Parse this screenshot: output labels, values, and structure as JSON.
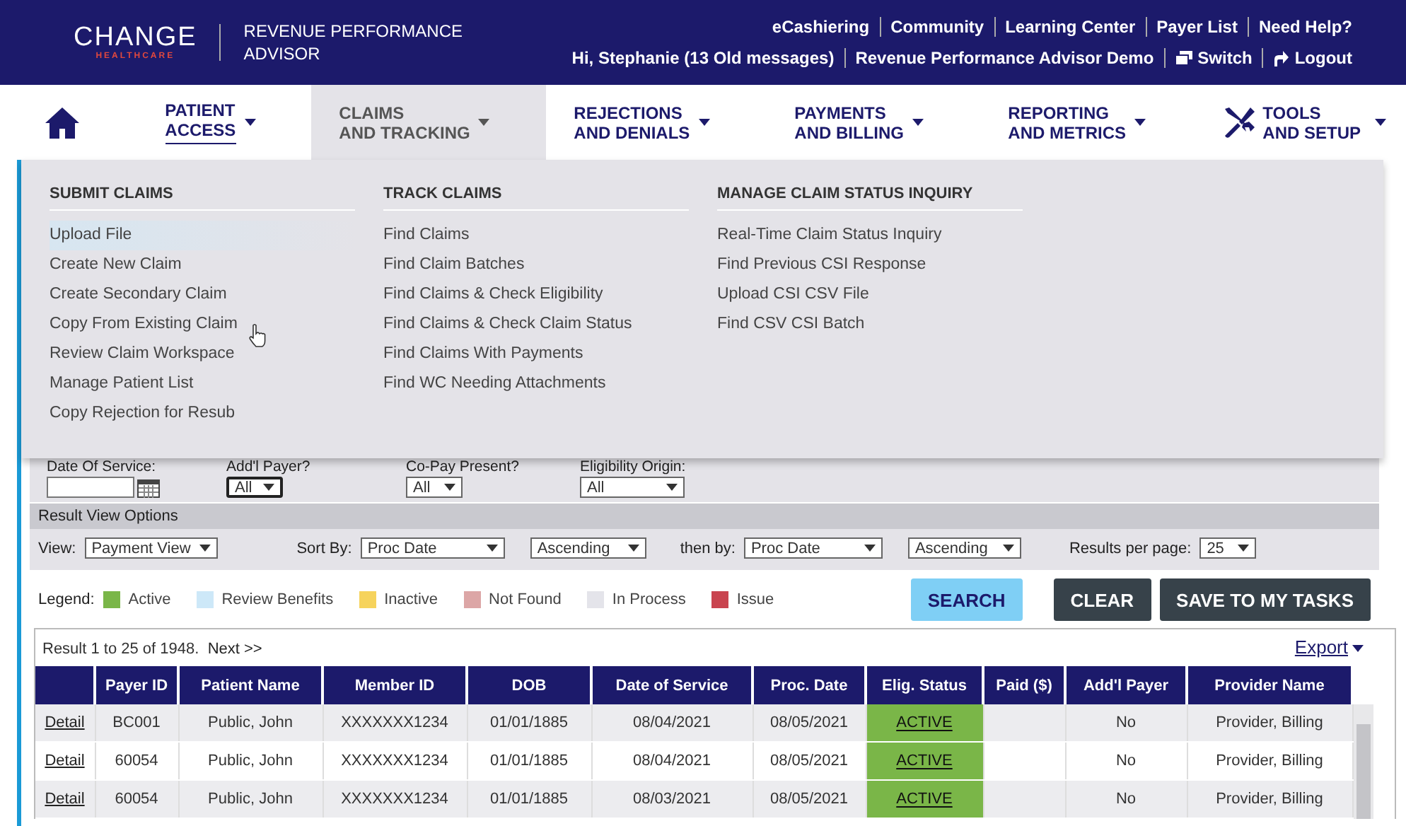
{
  "header": {
    "logo": "CHANGE",
    "logo_sub": "HEALTHCARE",
    "product": "REVENUE PERFORMANCE ADVISOR",
    "top_links": [
      "eCashiering",
      "Community",
      "Learning Center",
      "Payer List",
      "Need Help?"
    ],
    "user_links": [
      {
        "kind": "text",
        "label": "Hi, Stephanie (13 Old messages)"
      },
      {
        "kind": "text",
        "label": "Revenue Performance Advisor Demo"
      },
      {
        "kind": "switch",
        "label": "Switch"
      },
      {
        "kind": "logout",
        "label": "Logout"
      }
    ]
  },
  "nav": {
    "items": [
      {
        "label": "PATIENT\nACCESS",
        "selected": false,
        "current": true,
        "kind": "plain"
      },
      {
        "label": "CLAIMS\nAND TRACKING",
        "selected": true,
        "current": false,
        "kind": "plain"
      },
      {
        "label": "REJECTIONS\nAND DENIALS",
        "selected": false,
        "current": false,
        "kind": "plain"
      },
      {
        "label": "PAYMENTS\nAND BILLING",
        "selected": false,
        "current": false,
        "kind": "plain"
      },
      {
        "label": "REPORTING\nAND METRICS",
        "selected": false,
        "current": false,
        "kind": "plain"
      },
      {
        "label": "TOOLS\nAND SETUP",
        "selected": false,
        "current": false,
        "kind": "tools"
      }
    ]
  },
  "menu": {
    "columns": [
      {
        "title": "SUBMIT CLAIMS",
        "items": [
          {
            "label": "Upload File",
            "highlighted": true
          },
          {
            "label": "Create New Claim",
            "highlighted": false
          },
          {
            "label": "Create Secondary Claim",
            "highlighted": false
          },
          {
            "label": "Copy From Existing Claim",
            "highlighted": false
          },
          {
            "label": "Review Claim Workspace",
            "highlighted": false
          },
          {
            "label": "Manage Patient List",
            "highlighted": false
          },
          {
            "label": "Copy Rejection for Resub",
            "highlighted": false
          }
        ]
      },
      {
        "title": "TRACK CLAIMS",
        "items": [
          {
            "label": "Find Claims",
            "highlighted": false
          },
          {
            "label": "Find Claim Batches",
            "highlighted": false
          },
          {
            "label": "Find Claims & Check Eligibility",
            "highlighted": false
          },
          {
            "label": "Find Claims & Check Claim Status",
            "highlighted": false
          },
          {
            "label": "Find Claims With Payments",
            "highlighted": false
          },
          {
            "label": "Find WC Needing Attachments",
            "highlighted": false
          }
        ]
      },
      {
        "title": "MANAGE CLAIM STATUS INQUIRY",
        "items": [
          {
            "label": "Real-Time Claim Status Inquiry",
            "highlighted": false
          },
          {
            "label": "Find Previous CSI Response",
            "highlighted": false
          },
          {
            "label": "Upload CSI CSV File",
            "highlighted": false
          },
          {
            "label": "Find CSV CSI Batch",
            "highlighted": false
          }
        ]
      }
    ]
  },
  "filters": [
    {
      "label": "Date Of Service:",
      "kind": "date",
      "focused": false
    },
    {
      "label": "Add'l Payer?",
      "kind": "select",
      "value": "All",
      "focused": true
    },
    {
      "label": "Co-Pay Present?",
      "kind": "select",
      "value": "All",
      "focused": false
    },
    {
      "label": "Eligibility Origin:",
      "kind": "select",
      "value": "All",
      "focused": false
    }
  ],
  "result_view": {
    "title": "Result View Options",
    "controls": [
      {
        "label": "View:",
        "value": "Payment View"
      },
      {
        "label": "Sort By:",
        "value": "Proc Date"
      },
      {
        "value": "Ascending"
      },
      {
        "label": "then by:",
        "value": "Proc Date"
      },
      {
        "value": "Ascending"
      },
      {
        "label": "Results per page:",
        "value": "25"
      }
    ]
  },
  "legend": {
    "title": "Legend:",
    "items": [
      {
        "label": "Active",
        "color": "#7ab648"
      },
      {
        "label": "Review Benefits",
        "color": "#cde8f8"
      },
      {
        "label": "Inactive",
        "color": "#f6d35c"
      },
      {
        "label": "Not Found",
        "color": "#dca6a6"
      },
      {
        "label": "In Process",
        "color": "#e4e4ea"
      },
      {
        "label": "Issue",
        "color": "#c9444f"
      }
    ]
  },
  "buttons": [
    {
      "label": "SEARCH",
      "kind": "primary"
    },
    {
      "label": "CLEAR",
      "kind": "dark"
    },
    {
      "label": "SAVE TO MY TASKS",
      "kind": "dark"
    }
  ],
  "results": {
    "summary": "Result 1 to 25 of 1948.",
    "next": "Next >>",
    "export": "Export",
    "columns": [
      "Payer ID",
      "Patient Name",
      "Member ID",
      "DOB",
      "Date of Service",
      "Proc. Date",
      "Elig. Status",
      "Paid ($)",
      "Add'l Payer",
      "Provider Name"
    ],
    "rows": [
      {
        "link": "Detail",
        "color": "#7ab648",
        "cells": [
          "BC001",
          "Public, John",
          "XXXXXXX1234",
          "01/01/1885",
          "08/04/2021",
          "08/05/2021",
          "ACTIVE",
          null,
          "No",
          "Provider, Billing"
        ]
      },
      {
        "link": "Detail",
        "color": "#7ab648",
        "cells": [
          "60054",
          "Public, John",
          "XXXXXXX1234",
          "01/01/1885",
          "08/04/2021",
          "08/05/2021",
          "ACTIVE",
          null,
          "No",
          "Provider, Billing"
        ]
      },
      {
        "link": "Detail",
        "color": "#7ab648",
        "cells": [
          "60054",
          "Public, John",
          "XXXXXXX1234",
          "01/01/1885",
          "08/03/2021",
          "08/05/2021",
          "ACTIVE",
          null,
          "No",
          "Provider, Billing"
        ]
      }
    ]
  }
}
